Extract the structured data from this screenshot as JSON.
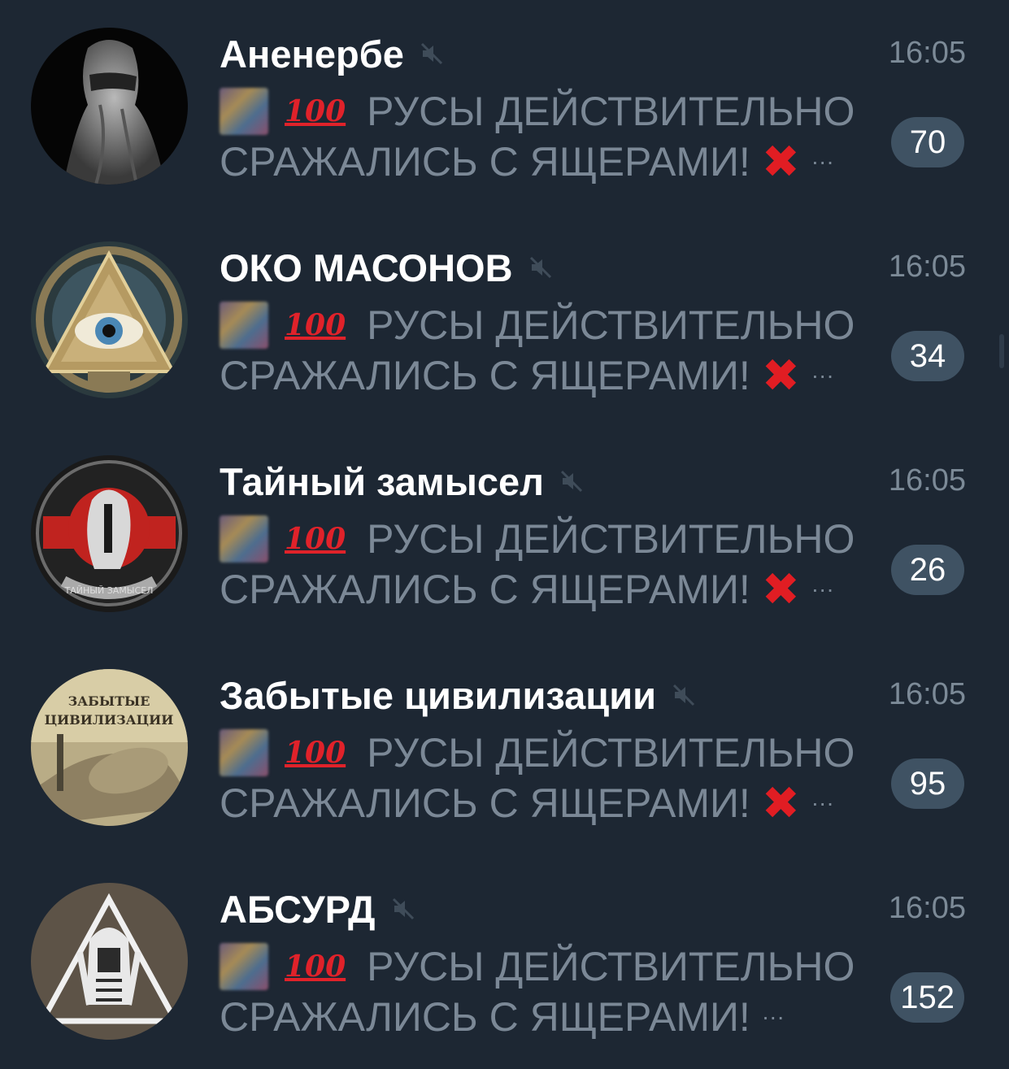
{
  "chats": [
    {
      "title": "Аненербе",
      "time": "16:05",
      "preview_line1": "РУСЫ ДЕЙСТВИТЕЛЬНО",
      "preview_line2": "СРАЖАЛИСЬ С ЯЩЕРАМИ!",
      "has_cross": true,
      "unread": "70",
      "avatar": "hooded-statue"
    },
    {
      "title": "ОКО МАСОНОВ",
      "time": "16:05",
      "preview_line1": "РУСЫ ДЕЙСТВИТЕЛЬНО",
      "preview_line2": "СРАЖАЛИСЬ С ЯЩЕРАМИ!",
      "has_cross": true,
      "unread": "34",
      "avatar": "all-seeing-eye"
    },
    {
      "title": "Тайный замысел",
      "time": "16:05",
      "preview_line1": "РУСЫ ДЕЙСТВИТЕЛЬНО",
      "preview_line2": "СРАЖАЛИСЬ С ЯЩЕРАМИ!",
      "has_cross": true,
      "unread": "26",
      "avatar": "secret-plan-logo",
      "avatar_text": "ТАЙНЫЙ ЗАМЫСЕЛ"
    },
    {
      "title": "Забытые цивилизации",
      "time": "16:05",
      "preview_line1": "РУСЫ ДЕЙСТВИТЕЛЬНО",
      "preview_line2": "СРАЖАЛИСЬ С ЯЩЕРАМИ!",
      "has_cross": true,
      "unread": "95",
      "avatar": "ancient-statue",
      "avatar_text1": "ЗАБЫТЫЕ",
      "avatar_text2": "ЦИВИЛИЗАЦИИ"
    },
    {
      "title": "АБСУРД",
      "time": "16:05",
      "preview_line1": "РУСЫ ДЕЙСТВИТЕЛЬНО",
      "preview_line2": "СРАЖАЛИСЬ С ЯЩЕРАМИ!",
      "has_cross": false,
      "unread": "152",
      "avatar": "pharaoh-logo"
    }
  ],
  "icons": {
    "mute": "muted-speaker-icon",
    "hundred": "💯",
    "cross": "✖",
    "ellipsis": "···"
  },
  "colors": {
    "background": "#1d2733",
    "badge": "#3f5263",
    "muted_text": "#7b8896",
    "cross": "#e11d23",
    "hundred": "#e0222a"
  }
}
